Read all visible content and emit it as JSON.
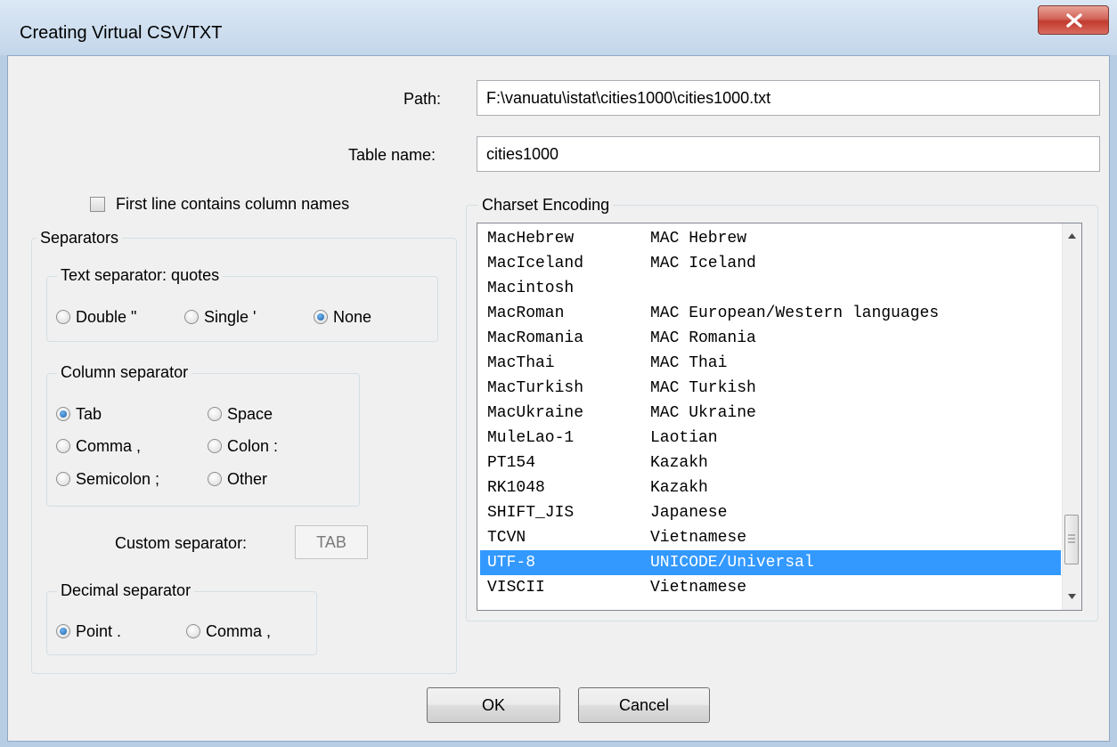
{
  "window": {
    "title": "Creating Virtual CSV/TXT"
  },
  "path": {
    "label": "Path:",
    "value": "F:\\vanuatu\\istat\\cities1000\\cities1000.txt"
  },
  "table_name": {
    "label": "Table name:",
    "value": "cities1000"
  },
  "first_line": {
    "label": "First line contains column names",
    "checked": false
  },
  "separators": {
    "title": "Separators",
    "text_separator": {
      "title": "Text separator: quotes",
      "options": [
        "Double \"",
        "Single '",
        "None"
      ],
      "selected": "None"
    },
    "column_separator": {
      "title": "Column separator",
      "options": [
        "Tab",
        "Space",
        "Comma ,",
        "Colon :",
        "Semicolon ;",
        "Other"
      ],
      "selected": "Tab"
    },
    "custom_separator": {
      "label": "Custom separator:",
      "value": "TAB"
    },
    "decimal_separator": {
      "title": "Decimal separator",
      "options": [
        "Point .",
        "Comma ,"
      ],
      "selected": "Point ."
    }
  },
  "charset": {
    "title": "Charset Encoding",
    "items": [
      {
        "code": "MacHebrew",
        "desc": "MAC Hebrew"
      },
      {
        "code": "MacIceland",
        "desc": "MAC Iceland"
      },
      {
        "code": "Macintosh",
        "desc": ""
      },
      {
        "code": "MacRoman",
        "desc": "MAC European/Western languages"
      },
      {
        "code": "MacRomania",
        "desc": "MAC Romania"
      },
      {
        "code": "MacThai",
        "desc": "MAC Thai"
      },
      {
        "code": "MacTurkish",
        "desc": "MAC Turkish"
      },
      {
        "code": "MacUkraine",
        "desc": "MAC Ukraine"
      },
      {
        "code": "MuleLao-1",
        "desc": "Laotian"
      },
      {
        "code": "PT154",
        "desc": "Kazakh"
      },
      {
        "code": "RK1048",
        "desc": "Kazakh"
      },
      {
        "code": "SHIFT_JIS",
        "desc": "Japanese"
      },
      {
        "code": "TCVN",
        "desc": "Vietnamese"
      },
      {
        "code": "UTF-8",
        "desc": "UNICODE/Universal"
      },
      {
        "code": "VISCII",
        "desc": "Vietnamese"
      }
    ],
    "selected": "UTF-8"
  },
  "buttons": {
    "ok": "OK",
    "cancel": "Cancel"
  },
  "icons": {
    "close": "close-icon",
    "scroll_up": "chevron-up-icon",
    "scroll_down": "chevron-down-icon",
    "thumb_grip": "grip-icon"
  },
  "colors": {
    "selection": "#3399ff",
    "close_button": "#c23b2f",
    "dialog_bg": "#f0f0f0"
  }
}
